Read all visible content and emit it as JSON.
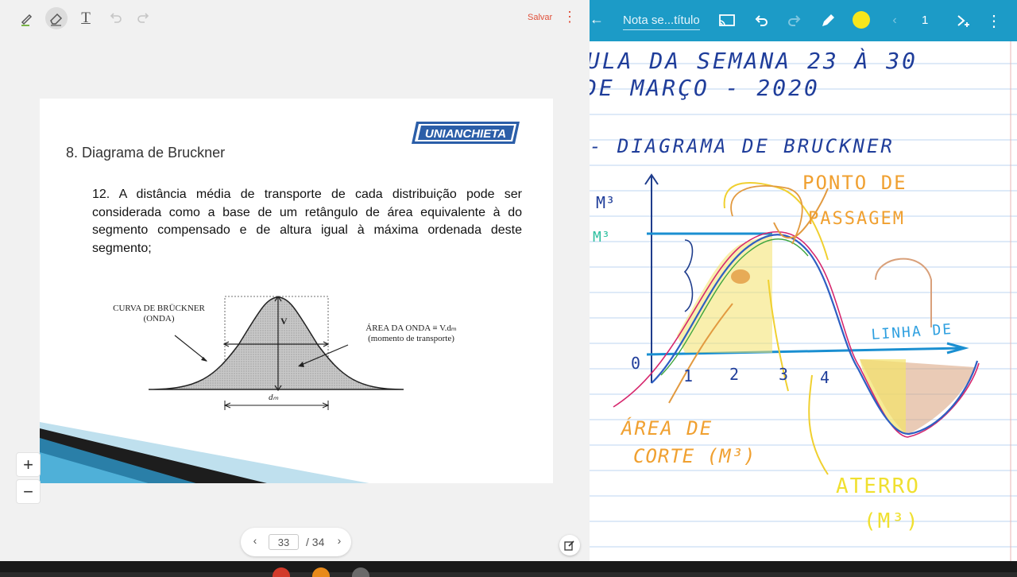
{
  "left_toolbar": {
    "tools": [
      {
        "name": "pen",
        "icon": "pen-icon"
      },
      {
        "name": "eraser",
        "icon": "eraser-icon",
        "active": true
      },
      {
        "name": "text",
        "icon": "text-icon",
        "glyph": "T"
      },
      {
        "name": "undo",
        "icon": "undo-icon",
        "disabled": true
      },
      {
        "name": "redo",
        "icon": "redo-icon",
        "disabled": true
      }
    ],
    "save_label": "Salvar",
    "menu_glyph": "⋮",
    "accent_color": "#e0503a"
  },
  "slide": {
    "logo_text": "UNIANCHIETA",
    "heading": "8. Diagrama de Bruckner",
    "body": "12. A distância média de transporte de cada distribuição pode ser considerada como a base de um retângulo de área equivalente à do segmento compensado e de altura igual à máxima ordenada deste segmento;",
    "figure": {
      "label_curve": "CURVA DE BRÜCKNER",
      "label_curve_sub": "(ONDA)",
      "label_area": "ÁREA DA ONDA ≡ V.dₘ",
      "label_area_sub": "(momento de transporte)",
      "label_v": "V",
      "label_dm": "dₘ"
    }
  },
  "viewer": {
    "zoom_in": "+",
    "zoom_out": "−",
    "page_prev": "‹",
    "page_next": "›",
    "current_page": "33",
    "total_pages": "/ 34"
  },
  "note_app": {
    "title": "Nota se...título",
    "page_number": "1",
    "toolbar_color": "#1c9bc7",
    "pen_color": "#f7e61c",
    "icons": [
      "cast-icon",
      "undo-icon",
      "redo-icon",
      "pen-icon",
      "color-dot",
      "prev-page-icon",
      "add-page-icon",
      "more-icon"
    ],
    "handwriting": {
      "line1": "ULA DA SEMANA 23 À 30",
      "line2": "DE MARÇO - 2020",
      "line3": "- DIAGRAMA DE BRUCKNER",
      "ponto": "PONTO DE",
      "passagem": "PASSAGEM",
      "linha": "LINHA DE",
      "area": "ÁREA DE",
      "corte": "CORTE (M³)",
      "aterro": "ATERRO",
      "aterro_unit": "(M³)",
      "axis_unit_top": "M³",
      "axis_unit_side": "M³",
      "axis_zero": "0",
      "axis_ticks": [
        "1",
        "2",
        "3",
        "4"
      ]
    }
  }
}
